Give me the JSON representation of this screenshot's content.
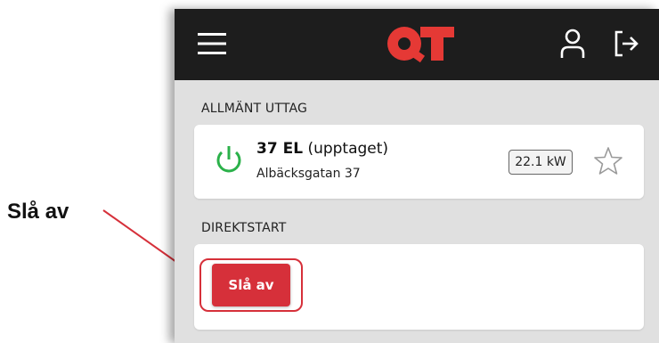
{
  "annotation": {
    "label": "Slå av"
  },
  "header": {
    "logo_text": "QT"
  },
  "outlet_section": {
    "title": "ALLMÄNT UTTAG",
    "outlet": {
      "name": "37 EL",
      "status": "(upptaget)",
      "address": "Albäcksgatan 37",
      "power": "22.1 kW"
    }
  },
  "direct_section": {
    "title": "DIREKTSTART",
    "stop_label": "Slå av"
  },
  "colors": {
    "accent": "#d6303a",
    "power_on": "#2bb14a",
    "topbar": "#1d1d1d",
    "background": "#e0e0e0"
  }
}
